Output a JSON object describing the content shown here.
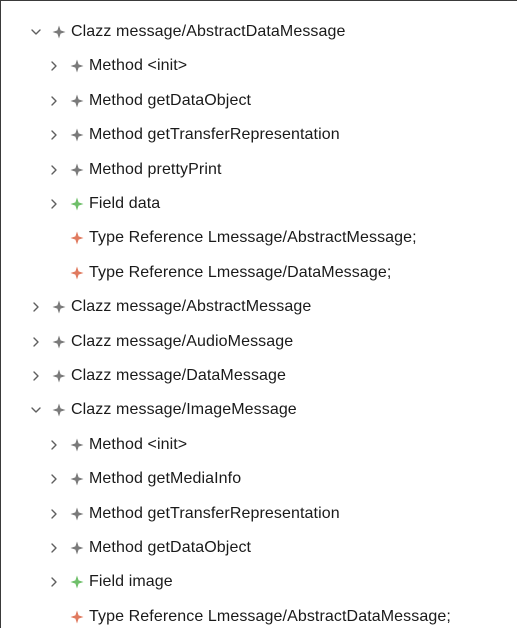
{
  "colors": {
    "gray_icon": "#7a7a7a",
    "field_icon": "#6fbf6a",
    "typeref_icon": "#e07a5f",
    "chevron": "#5f5f5f"
  },
  "rows": [
    {
      "level": 0,
      "toggle": "expanded",
      "icon": "gray-star-icon",
      "label": "Clazz message/AbstractDataMessage"
    },
    {
      "level": 1,
      "toggle": "collapsed",
      "icon": "gray-star-icon",
      "label": "Method <init>"
    },
    {
      "level": 1,
      "toggle": "collapsed",
      "icon": "gray-star-icon",
      "label": "Method getDataObject"
    },
    {
      "level": 1,
      "toggle": "collapsed",
      "icon": "gray-star-icon",
      "label": "Method getTransferRepresentation"
    },
    {
      "level": 1,
      "toggle": "collapsed",
      "icon": "gray-star-icon",
      "label": "Method prettyPrint"
    },
    {
      "level": 1,
      "toggle": "collapsed",
      "icon": "green-star-icon",
      "label": "Field data"
    },
    {
      "level": 1,
      "toggle": "none",
      "icon": "orange-star-icon",
      "label": "Type Reference Lmessage/AbstractMessage;"
    },
    {
      "level": 1,
      "toggle": "none",
      "icon": "orange-star-icon",
      "label": "Type Reference Lmessage/DataMessage;"
    },
    {
      "level": 0,
      "toggle": "collapsed",
      "icon": "gray-star-icon",
      "label": "Clazz message/AbstractMessage"
    },
    {
      "level": 0,
      "toggle": "collapsed",
      "icon": "gray-star-icon",
      "label": "Clazz message/AudioMessage"
    },
    {
      "level": 0,
      "toggle": "collapsed",
      "icon": "gray-star-icon",
      "label": "Clazz message/DataMessage"
    },
    {
      "level": 0,
      "toggle": "expanded",
      "icon": "gray-star-icon",
      "label": "Clazz message/ImageMessage"
    },
    {
      "level": 1,
      "toggle": "collapsed",
      "icon": "gray-star-icon",
      "label": "Method <init>"
    },
    {
      "level": 1,
      "toggle": "collapsed",
      "icon": "gray-star-icon",
      "label": "Method getMediaInfo"
    },
    {
      "level": 1,
      "toggle": "collapsed",
      "icon": "gray-star-icon",
      "label": "Method getTransferRepresentation"
    },
    {
      "level": 1,
      "toggle": "collapsed",
      "icon": "gray-star-icon",
      "label": "Method getDataObject"
    },
    {
      "level": 1,
      "toggle": "collapsed",
      "icon": "green-star-icon",
      "label": "Field image"
    },
    {
      "level": 1,
      "toggle": "none",
      "icon": "orange-star-icon",
      "label": "Type Reference Lmessage/AbstractDataMessage;"
    }
  ]
}
